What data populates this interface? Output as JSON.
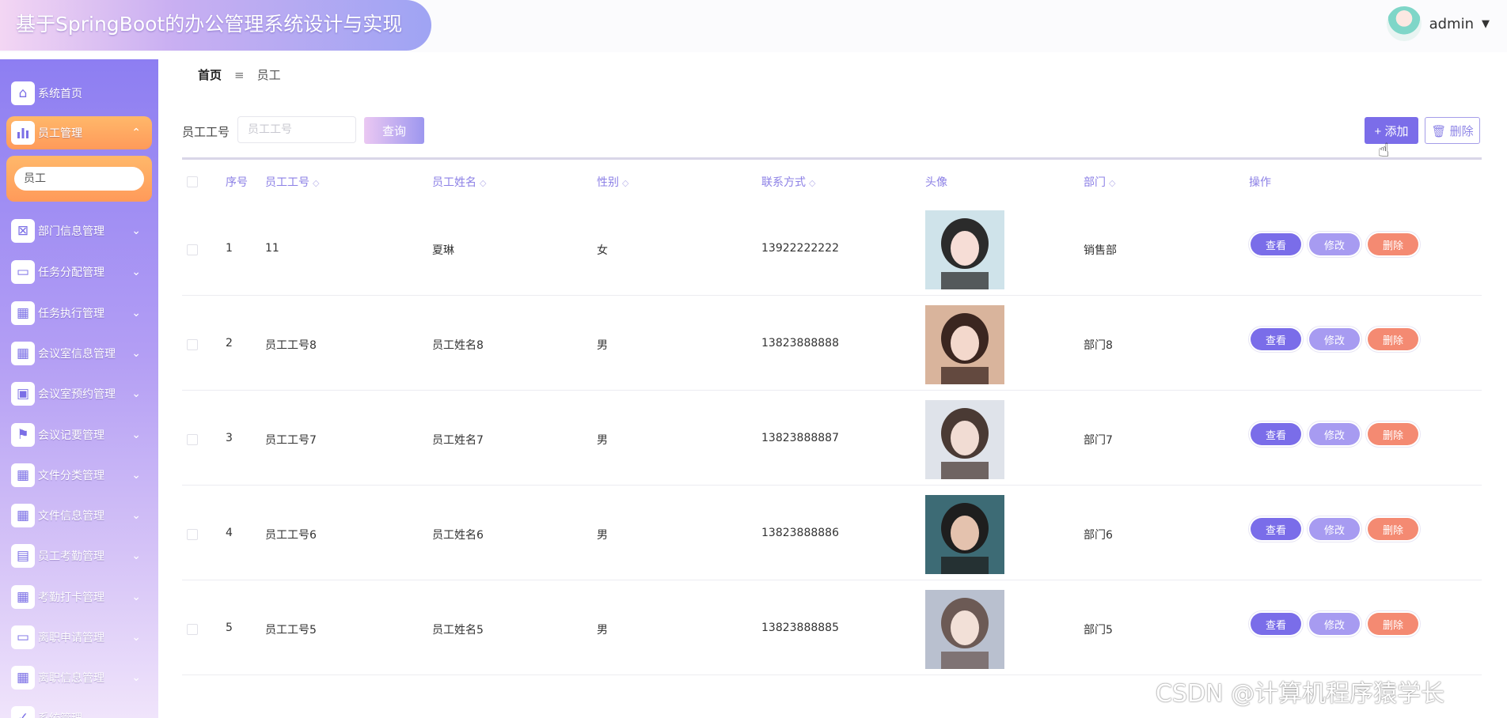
{
  "header": {
    "app_title": "基于SpringBoot的办公管理系统设计与实现",
    "user_name": "admin"
  },
  "sidebar": {
    "home": "系统首页",
    "active": "员工管理",
    "submenu_item": "员工",
    "items": [
      "部门信息管理",
      "任务分配管理",
      "任务执行管理",
      "会议室信息管理",
      "会议室预约管理",
      "会议记要管理",
      "文件分类管理",
      "文件信息管理",
      "员工考勤管理",
      "考勤打卡管理",
      "离职申请管理",
      "离职信息管理",
      "系统管理"
    ]
  },
  "breadcrumb": {
    "home": "首页",
    "separator": "≡",
    "current": "员工"
  },
  "search": {
    "label": "员工工号",
    "placeholder": "员工工号",
    "query_label": "查询"
  },
  "toolbar": {
    "add_label": "+ 添加",
    "delete_label": "🗑 删除"
  },
  "table": {
    "headers": {
      "index": "序号",
      "emp_no": "员工工号",
      "emp_name": "员工姓名",
      "gender": "性别",
      "phone": "联系方式",
      "avatar": "头像",
      "dept": "部门",
      "ops": "操作"
    },
    "ops": {
      "view": "查看",
      "edit": "修改",
      "delete": "删除"
    },
    "rows": [
      {
        "index": "1",
        "emp_no": "11",
        "emp_name": "夏琳",
        "gender": "女",
        "phone": "13922222222",
        "dept": "销售部"
      },
      {
        "index": "2",
        "emp_no": "员工工号8",
        "emp_name": "员工姓名8",
        "gender": "男",
        "phone": "13823888888",
        "dept": "部门8"
      },
      {
        "index": "3",
        "emp_no": "员工工号7",
        "emp_name": "员工姓名7",
        "gender": "男",
        "phone": "13823888887",
        "dept": "部门7"
      },
      {
        "index": "4",
        "emp_no": "员工工号6",
        "emp_name": "员工姓名6",
        "gender": "男",
        "phone": "13823888886",
        "dept": "部门6"
      },
      {
        "index": "5",
        "emp_no": "员工工号5",
        "emp_name": "员工姓名5",
        "gender": "男",
        "phone": "13823888885",
        "dept": "部门5"
      }
    ]
  },
  "watermark": "CSDN @计算机程序猿学长"
}
